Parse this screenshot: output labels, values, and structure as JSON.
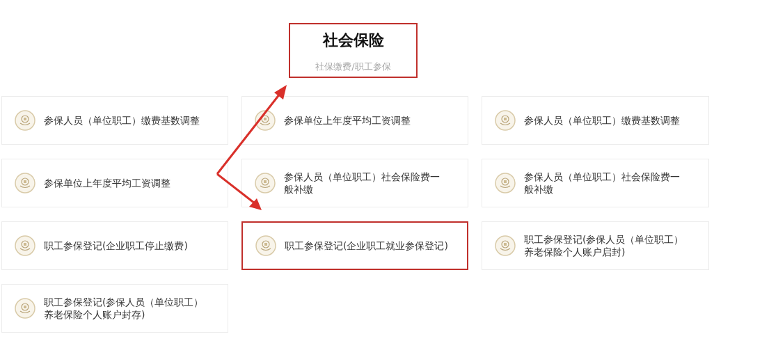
{
  "header": {
    "title": "社会保险",
    "subtitle": "社保缴费/职工参保",
    "highlighted": true
  },
  "services": [
    {
      "label": "参保人员（单位职工）缴费基数调整",
      "highlighted": false
    },
    {
      "label": "参保单位上年度平均工资调整",
      "highlighted": false
    },
    {
      "label": "参保人员（单位职工）缴费基数调整",
      "highlighted": false
    },
    {
      "label": "参保单位上年度平均工资调整",
      "highlighted": false
    },
    {
      "label": "参保人员（单位职工）社会保险费一般补缴",
      "highlighted": false
    },
    {
      "label": "参保人员（单位职工）社会保险费一般补缴",
      "highlighted": false
    },
    {
      "label": "职工参保登记(企业职工停止缴费)",
      "highlighted": false
    },
    {
      "label": "职工参保登记(企业职工就业参保登记)",
      "highlighted": true
    },
    {
      "label": "职工参保登记(参保人员（单位职工）养老保险个人账户启封)",
      "highlighted": false
    },
    {
      "label": "职工参保登记(参保人员（单位职工）养老保险个人账户封存)",
      "highlighted": false
    }
  ]
}
